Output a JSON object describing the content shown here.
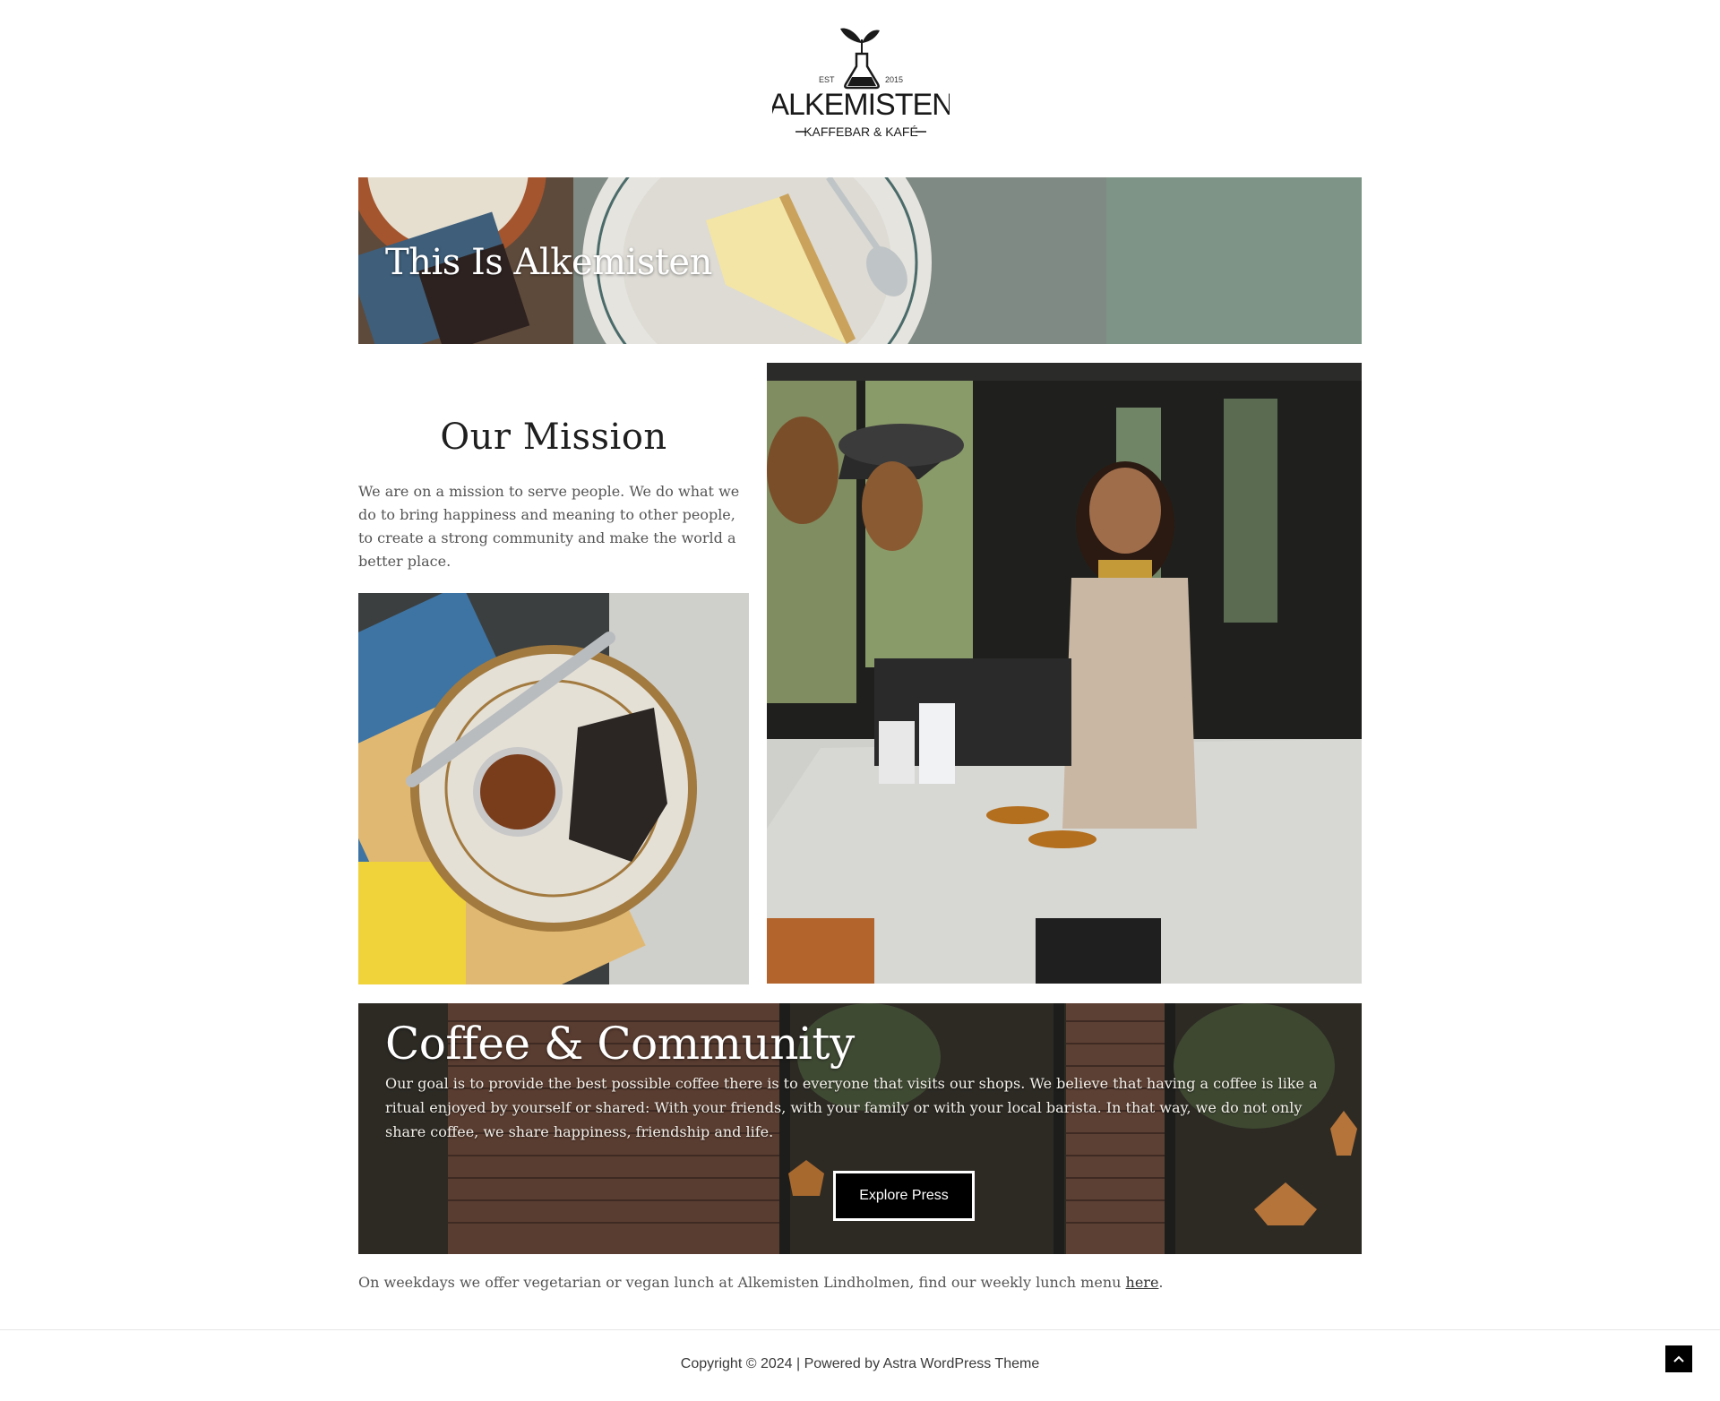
{
  "logo": {
    "est_left": "EST",
    "est_right": "2015",
    "name": "ALKEMISTEN",
    "tagline": "KAFFEBAR & KAFÉ"
  },
  "hero": {
    "title": "This Is Alkemisten"
  },
  "mission": {
    "title": "Our Mission",
    "text": "We are on a mission to serve people. We do what we do to bring happiness and meaning to other people, to create a strong community and make the world a better place."
  },
  "community": {
    "title": "Coffee & Community",
    "text": "Our goal is to provide the best possible coffee there is to everyone that visits our shops. We believe that having a coffee is like a ritual enjoyed by yourself or shared: With your friends, with your family or with your local barista. In that way, we do not only share coffee, we share happiness, friendship and life.",
    "button_label": "Explore Press"
  },
  "lunch": {
    "text": "On weekdays we offer vegetarian or vegan lunch at Alkemisten Lindholmen, find our weekly lunch menu ",
    "link_label": "here",
    "suffix": "."
  },
  "footer": {
    "copyright": "Copyright © 2024 | Powered by Astra WordPress Theme"
  },
  "icons": {
    "scroll_top": "chevron-up-icon"
  }
}
